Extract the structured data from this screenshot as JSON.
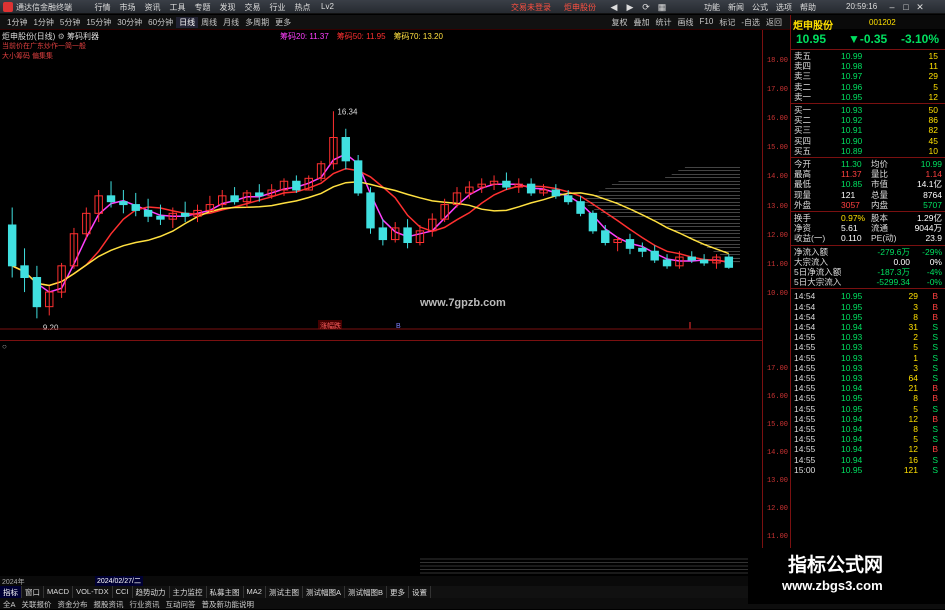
{
  "titlebar": {
    "app_title": "通达信金融终端",
    "menu": [
      "行情",
      "市场",
      "资讯",
      "工具",
      "专题",
      "发现",
      "交易",
      "行业",
      "热点",
      "Lv2"
    ],
    "trade_link": "交易未登录",
    "stock_link": "炬申股份",
    "right_menu": [
      "功能",
      "新闻",
      "公式",
      "选项",
      "帮助"
    ],
    "clock": "20:59:16"
  },
  "toolbar": {
    "periods": [
      "1分钟",
      "1分钟",
      "5分钟",
      "15分钟",
      "30分钟",
      "60分钟",
      "日线",
      "周线",
      "月线",
      "多周期",
      "更多"
    ],
    "selected_period": "日线",
    "right_tools": [
      "复权",
      "叠加",
      "统计",
      "画线",
      "F10",
      "标记",
      "-自选",
      "返回"
    ]
  },
  "chart": {
    "stock_name": "炬申股份(日线)",
    "indicator": "筹码利器",
    "legend": [
      {
        "label": "筹码20: 11.37",
        "color": "#ff40ff"
      },
      {
        "label": "筹码50: 11.95",
        "color": "#ff3030"
      },
      {
        "label": "筹码70: 13.20",
        "color": "#ffe040"
      }
    ],
    "notes": [
      "当前价在广东炒作一简一般",
      "大小筹码 偏集集"
    ],
    "high_label": "16.34",
    "low_label": "9.20",
    "watermark": "www.7gpzb.com",
    "signal_labels": [
      "涨幅跌",
      "B"
    ],
    "main_axis": [
      "18.00",
      "17.00",
      "16.00",
      "15.00",
      "14.00",
      "13.00",
      "12.00",
      "11.00",
      "10.00"
    ],
    "sub_axis": [
      "17.00",
      "16.00",
      "15.00",
      "14.00",
      "13.00",
      "12.00",
      "11.00",
      "10.00"
    ],
    "date_left": "2024年",
    "date_mid": "2024/02/27/二",
    "candles": [
      [
        12.4,
        13.0,
        10.6,
        11.0
      ],
      [
        11.0,
        11.6,
        10.1,
        10.6
      ],
      [
        10.6,
        11.0,
        9.2,
        9.6
      ],
      [
        9.6,
        10.3,
        9.3,
        10.1
      ],
      [
        10.1,
        11.1,
        9.9,
        11.0
      ],
      [
        11.0,
        12.3,
        10.9,
        12.1
      ],
      [
        12.1,
        13.0,
        11.9,
        12.8
      ],
      [
        12.8,
        13.6,
        12.5,
        13.4
      ],
      [
        13.4,
        13.9,
        13.0,
        13.2
      ],
      [
        13.2,
        13.6,
        12.8,
        13.1
      ],
      [
        13.1,
        13.5,
        12.7,
        12.9
      ],
      [
        12.9,
        13.3,
        12.5,
        12.7
      ],
      [
        12.7,
        13.1,
        12.4,
        12.6
      ],
      [
        12.6,
        13.0,
        12.3,
        12.8
      ],
      [
        12.8,
        13.2,
        12.5,
        12.7
      ],
      [
        12.7,
        13.1,
        12.5,
        12.9
      ],
      [
        12.9,
        13.4,
        12.8,
        13.1
      ],
      [
        13.1,
        13.6,
        13.0,
        13.4
      ],
      [
        13.4,
        13.7,
        13.1,
        13.2
      ],
      [
        13.2,
        13.6,
        13.0,
        13.5
      ],
      [
        13.5,
        13.8,
        13.2,
        13.4
      ],
      [
        13.4,
        13.8,
        13.3,
        13.6
      ],
      [
        13.6,
        14.0,
        13.4,
        13.9
      ],
      [
        13.9,
        14.1,
        13.5,
        13.6
      ],
      [
        13.6,
        14.1,
        13.6,
        14.0
      ],
      [
        14.0,
        14.6,
        13.9,
        14.5
      ],
      [
        14.5,
        16.3,
        14.3,
        15.4
      ],
      [
        15.4,
        15.7,
        14.3,
        14.6
      ],
      [
        14.6,
        14.8,
        13.4,
        13.5
      ],
      [
        13.5,
        13.7,
        12.1,
        12.3
      ],
      [
        12.3,
        12.6,
        11.7,
        11.9
      ],
      [
        11.9,
        12.5,
        11.8,
        12.3
      ],
      [
        12.3,
        12.6,
        11.6,
        11.8
      ],
      [
        11.8,
        12.4,
        11.7,
        12.2
      ],
      [
        12.2,
        12.8,
        12.0,
        12.6
      ],
      [
        12.6,
        13.3,
        12.5,
        13.1
      ],
      [
        13.1,
        13.7,
        13.0,
        13.5
      ],
      [
        13.5,
        13.9,
        13.3,
        13.7
      ],
      [
        13.7,
        14.0,
        13.5,
        13.8
      ],
      [
        13.8,
        14.1,
        13.6,
        13.9
      ],
      [
        13.9,
        14.2,
        13.6,
        13.7
      ],
      [
        13.7,
        14.0,
        13.5,
        13.8
      ],
      [
        13.8,
        14.0,
        13.4,
        13.5
      ],
      [
        13.5,
        13.8,
        13.4,
        13.6
      ],
      [
        13.6,
        13.8,
        13.3,
        13.4
      ],
      [
        13.4,
        13.6,
        13.1,
        13.2
      ],
      [
        13.2,
        13.4,
        12.7,
        12.8
      ],
      [
        12.8,
        12.9,
        12.1,
        12.2
      ],
      [
        12.2,
        12.4,
        11.7,
        11.8
      ],
      [
        11.8,
        12.0,
        11.5,
        11.9
      ],
      [
        11.9,
        12.1,
        11.4,
        11.6
      ],
      [
        11.6,
        11.8,
        11.3,
        11.5
      ],
      [
        11.5,
        11.7,
        11.1,
        11.2
      ],
      [
        11.2,
        11.4,
        10.9,
        11.0
      ],
      [
        11.0,
        11.5,
        10.9,
        11.3
      ],
      [
        11.3,
        11.5,
        11.1,
        11.2
      ],
      [
        11.2,
        11.4,
        11.0,
        11.1
      ],
      [
        11.1,
        11.4,
        10.9,
        11.3
      ],
      [
        11.3,
        11.4,
        10.9,
        10.95
      ]
    ]
  },
  "panel": {
    "name": "炬申股份",
    "code": "001202",
    "price": "10.95",
    "change": "▼-0.35",
    "pct": "-3.10%",
    "asks": [
      {
        "label": "卖五",
        "price": "10.99",
        "vol": "15"
      },
      {
        "label": "卖四",
        "price": "10.98",
        "vol": "11"
      },
      {
        "label": "卖三",
        "price": "10.97",
        "vol": "29"
      },
      {
        "label": "卖二",
        "price": "10.96",
        "vol": "5"
      },
      {
        "label": "卖一",
        "price": "10.95",
        "vol": "12"
      }
    ],
    "bids": [
      {
        "label": "买一",
        "price": "10.93",
        "vol": "50"
      },
      {
        "label": "买二",
        "price": "10.92",
        "vol": "86"
      },
      {
        "label": "买三",
        "price": "10.91",
        "vol": "82"
      },
      {
        "label": "买四",
        "price": "10.90",
        "vol": "45"
      },
      {
        "label": "买五",
        "price": "10.89",
        "vol": "10"
      }
    ],
    "stats": [
      {
        "l1": "今开",
        "v1": "11.30",
        "c1": "dn",
        "l2": "均价",
        "v2": "10.99",
        "c2": "dn"
      },
      {
        "l1": "最高",
        "v1": "11.37",
        "c1": "up",
        "l2": "量比",
        "v2": "1.14",
        "c2": "up"
      },
      {
        "l1": "最低",
        "v1": "10.85",
        "c1": "dn",
        "l2": "市值",
        "v2": "14.1亿",
        "c2": "wh"
      },
      {
        "l1": "现量",
        "v1": "121",
        "c1": "wh",
        "l2": "总量",
        "v2": "8764",
        "c2": "wh"
      },
      {
        "l1": "外盘",
        "v1": "3057",
        "c1": "up",
        "l2": "内盘",
        "v2": "5707",
        "c2": "dn"
      },
      {
        "l1": "换手",
        "v1": "0.97%",
        "c1": "yl",
        "l2": "股本",
        "v2": "1.29亿",
        "c2": "wh"
      },
      {
        "l1": "净资",
        "v1": "5.61",
        "c1": "wh",
        "l2": "流通",
        "v2": "9044万",
        "c2": "wh"
      },
      {
        "l1": "收益(一)",
        "v1": "0.110",
        "c1": "wh",
        "l2": "PE(动)",
        "v2": "23.9",
        "c2": "wh"
      }
    ],
    "flows": [
      {
        "label": "净流入额",
        "val": "-279.6万",
        "pct": "-29%",
        "c": "dn"
      },
      {
        "label": "大宗流入",
        "val": "0.00",
        "pct": "0%",
        "c": "wh"
      },
      {
        "label": "5日净流入额",
        "val": "-187.3万",
        "pct": "-4%",
        "c": "dn"
      },
      {
        "label": "5日大宗流入",
        "val": "-5299.34",
        "pct": "-0%",
        "c": "dn"
      }
    ],
    "ticks": [
      [
        "14:54",
        "10.95",
        "29",
        "B"
      ],
      [
        "14:54",
        "10.95",
        "3",
        "B"
      ],
      [
        "14:54",
        "10.95",
        "8",
        "B"
      ],
      [
        "14:54",
        "10.94",
        "31",
        "S"
      ],
      [
        "14:55",
        "10.93",
        "2",
        "S"
      ],
      [
        "14:55",
        "10.93",
        "5",
        "S"
      ],
      [
        "14:55",
        "10.93",
        "1",
        "S"
      ],
      [
        "14:55",
        "10.93",
        "3",
        "S"
      ],
      [
        "14:55",
        "10.93",
        "64",
        "S"
      ],
      [
        "14:55",
        "10.94",
        "21",
        "B"
      ],
      [
        "14:55",
        "10.95",
        "8",
        "B"
      ],
      [
        "14:55",
        "10.95",
        "5",
        "S"
      ],
      [
        "14:55",
        "10.94",
        "12",
        "B"
      ],
      [
        "14:55",
        "10.94",
        "8",
        "S"
      ],
      [
        "14:55",
        "10.94",
        "5",
        "S"
      ],
      [
        "14:55",
        "10.94",
        "12",
        "B"
      ],
      [
        "14:55",
        "10.94",
        "16",
        "S"
      ],
      [
        "15:00",
        "10.95",
        "121",
        "S"
      ]
    ]
  },
  "tabs": [
    "指标",
    "窗口",
    "MACD",
    "VOL-TDX",
    "CCI",
    "趋势动力",
    "主力监控",
    "私募主图",
    "MA2",
    "测试主图",
    "测试幅图A",
    "测试幅图B",
    "更多",
    "设置"
  ],
  "selected_tab": "指标",
  "footer": [
    "全A",
    "关联报价",
    "资金分布",
    "报股资讯",
    "行业资讯",
    "互动问答",
    "普及新功能说明"
  ],
  "brand": {
    "cn": "指标公式网",
    "url": "www.zbgs3.com"
  },
  "colors": {
    "up": "#ff4040",
    "down": "#00e060",
    "ma_short": "#ff40ff",
    "ma_mid": "#ff3030",
    "ma_long": "#ffe040"
  }
}
